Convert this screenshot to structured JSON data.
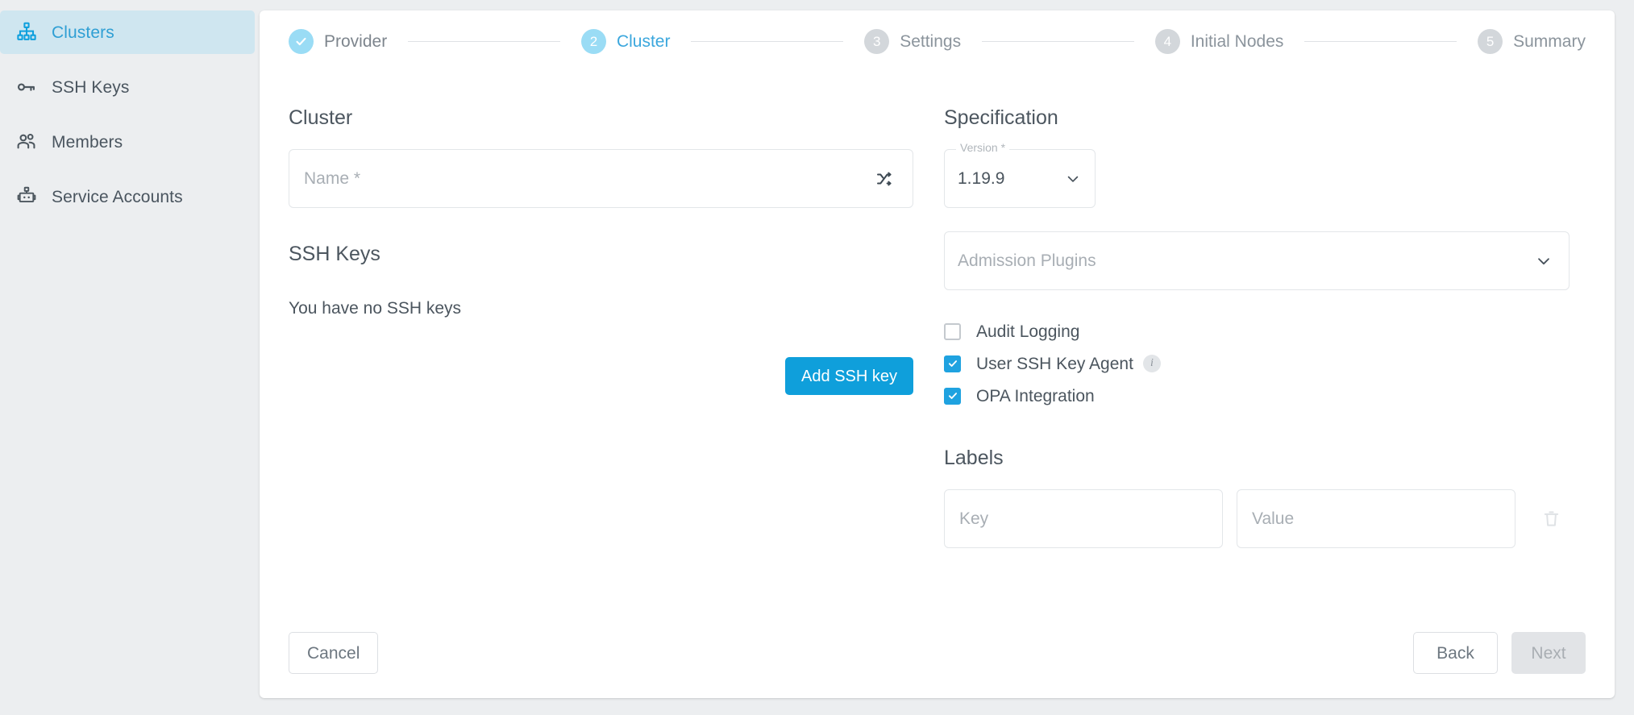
{
  "sidebar": {
    "items": [
      {
        "label": "Clusters",
        "icon": "hierarchy-icon",
        "active": true
      },
      {
        "label": "SSH Keys",
        "icon": "key-icon",
        "active": false
      },
      {
        "label": "Members",
        "icon": "people-icon",
        "active": false
      },
      {
        "label": "Service Accounts",
        "icon": "robot-icon",
        "active": false
      }
    ]
  },
  "stepper": {
    "steps": [
      {
        "number": "1",
        "label": "Provider",
        "state": "done"
      },
      {
        "number": "2",
        "label": "Cluster",
        "state": "current"
      },
      {
        "number": "3",
        "label": "Settings",
        "state": "upcoming"
      },
      {
        "number": "4",
        "label": "Initial Nodes",
        "state": "upcoming"
      },
      {
        "number": "5",
        "label": "Summary",
        "state": "upcoming"
      }
    ]
  },
  "cluster": {
    "section_title": "Cluster",
    "name_placeholder": "Name *",
    "name_value": "",
    "shuffle_icon": "shuffle-icon"
  },
  "ssh": {
    "section_title": "SSH Keys",
    "empty_text": "You have no SSH keys",
    "add_button": "Add SSH key"
  },
  "specification": {
    "section_title": "Specification",
    "version_label": "Version *",
    "version_value": "1.19.9",
    "admission_plugins_placeholder": "Admission Plugins",
    "options": [
      {
        "label": "Audit Logging",
        "checked": false,
        "info": false
      },
      {
        "label": "User SSH Key Agent",
        "checked": true,
        "info": true
      },
      {
        "label": "OPA Integration",
        "checked": true,
        "info": false
      }
    ]
  },
  "labels": {
    "section_title": "Labels",
    "key_placeholder": "Key",
    "key_value": "",
    "value_placeholder": "Value",
    "value_value": "",
    "delete_icon": "trash-icon"
  },
  "footer": {
    "cancel": "Cancel",
    "back": "Back",
    "next": "Next"
  },
  "colors": {
    "accent": "#0f9fdb",
    "accent_light": "#9adcf5",
    "sidebar_active_bg": "#cfe6f0",
    "page_bg": "#eceef0",
    "text": "#4b555e",
    "muted": "#a8aeb4"
  }
}
